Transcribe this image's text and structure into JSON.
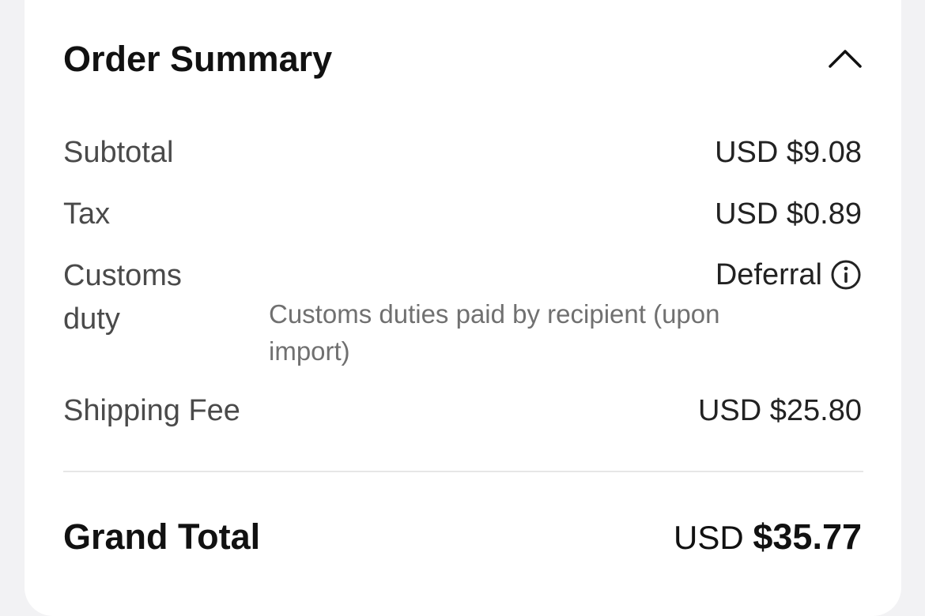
{
  "order_summary": {
    "title": "Order Summary",
    "collapse_icon": "chevron-up-icon",
    "rows": {
      "subtotal": {
        "label": "Subtotal",
        "value": "USD $9.08"
      },
      "tax": {
        "label": "Tax",
        "value": "USD $0.89"
      },
      "customs": {
        "label_line1": "Customs",
        "label_line2": "duty",
        "value": "Deferral",
        "info_icon": "info-icon",
        "note": "Customs duties paid by recipient (upon import)"
      },
      "shipping": {
        "label": "Shipping Fee",
        "value": "USD $25.80"
      }
    },
    "grand_total": {
      "label": "Grand Total",
      "currency": "USD ",
      "amount": "$35.77"
    }
  }
}
